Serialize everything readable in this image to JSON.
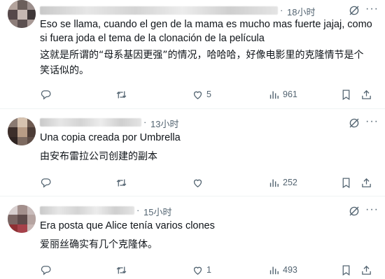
{
  "replies": [
    {
      "time": "18小时",
      "text_original": "Eso se llama, cuando el gen de la mama es mucho mas fuerte jajaj, como si fuera joda el tema de la clonación de la película",
      "text_translation": "这就是所谓的“母系基因更强”的情况，哈哈哈，好像电影里的克隆情节是个笑话似的。",
      "likes": "5",
      "views": "961",
      "retweets": "",
      "replies": ""
    },
    {
      "time": "13小时",
      "text_original": "Una copia creada por Umbrella",
      "text_translation": "由安布雷拉公司创建的副本",
      "likes": "",
      "views": "252",
      "retweets": "",
      "replies": ""
    },
    {
      "time": "15小时",
      "text_original": "Era posta que Alice tenía varios clones",
      "text_translation": "爱丽丝确实有几个克隆体。",
      "likes": "1",
      "views": "493",
      "retweets": "",
      "replies": ""
    }
  ],
  "separator": "·",
  "icons": [
    "reply-icon",
    "retweet-icon",
    "like-icon",
    "views-icon",
    "bookmark-icon",
    "share-icon",
    "grok-icon",
    "more-icon"
  ],
  "colors": {
    "text": "#0f1419",
    "secondary": "#536471",
    "divider": "#eff3f4"
  }
}
